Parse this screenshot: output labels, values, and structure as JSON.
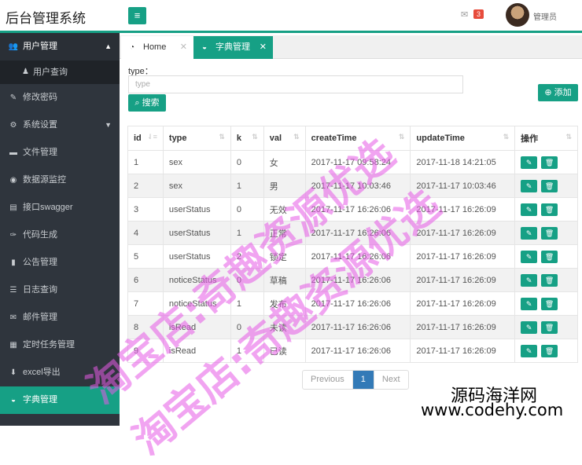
{
  "header": {
    "brand": "后台管理系统",
    "menu_icon": "≡",
    "mail_count": "3",
    "user": "管理员"
  },
  "sidebar": {
    "items": [
      {
        "icon": "users-icon",
        "glyph": "👥",
        "label": "用户管理"
      },
      {
        "icon": "key-icon",
        "glyph": "✎",
        "label": "修改密码"
      },
      {
        "icon": "gears-icon",
        "glyph": "⚙",
        "label": "系统设置"
      },
      {
        "icon": "folder-icon",
        "glyph": "▬",
        "label": "文件管理"
      },
      {
        "icon": "eye-icon",
        "glyph": "◉",
        "label": "数据源监控"
      },
      {
        "icon": "file-pdf-icon",
        "glyph": "▤",
        "label": "接口swagger"
      },
      {
        "icon": "wrench-icon",
        "glyph": "✑",
        "label": "代码生成"
      },
      {
        "icon": "book-icon",
        "glyph": "▮",
        "label": "公告管理"
      },
      {
        "icon": "list-icon",
        "glyph": "☰",
        "label": "日志查询"
      },
      {
        "icon": "envelope-icon",
        "glyph": "✉",
        "label": "邮件管理"
      },
      {
        "icon": "tasks-icon",
        "glyph": "▦",
        "label": "定时任务管理"
      },
      {
        "icon": "download-icon",
        "glyph": "⬇",
        "label": "excel导出"
      },
      {
        "icon": "dict-icon",
        "glyph": "◒",
        "label": "字典管理"
      }
    ],
    "sub_item": {
      "icon": "user-icon",
      "glyph": "♟",
      "label": "用户查询"
    }
  },
  "tabs": [
    {
      "label": "Home",
      "glyph": "◔"
    },
    {
      "label": "字典管理",
      "glyph": "◒"
    }
  ],
  "filter": {
    "label": "type：",
    "placeholder": "type",
    "search_label": "搜索",
    "add_label": "添加"
  },
  "table": {
    "columns": [
      "id",
      "type",
      "k",
      "val",
      "createTime",
      "updateTime",
      "操作"
    ],
    "rows": [
      [
        "1",
        "sex",
        "0",
        "女",
        "2017-11-17 09:58:24",
        "2017-11-18 14:21:05"
      ],
      [
        "2",
        "sex",
        "1",
        "男",
        "2017-11-17 10:03:46",
        "2017-11-17 10:03:46"
      ],
      [
        "3",
        "userStatus",
        "0",
        "无效",
        "2017-11-17 16:26:06",
        "2017-11-17 16:26:09"
      ],
      [
        "4",
        "userStatus",
        "1",
        "正常",
        "2017-11-17 16:26:06",
        "2017-11-17 16:26:09"
      ],
      [
        "5",
        "userStatus",
        "2",
        "锁定",
        "2017-11-17 16:26:06",
        "2017-11-17 16:26:09"
      ],
      [
        "6",
        "noticeStatus",
        "0",
        "草稿",
        "2017-11-17 16:26:06",
        "2017-11-17 16:26:09"
      ],
      [
        "7",
        "noticeStatus",
        "1",
        "发布",
        "2017-11-17 16:26:06",
        "2017-11-17 16:26:09"
      ],
      [
        "8",
        "isRead",
        "0",
        "未读",
        "2017-11-17 16:26:06",
        "2017-11-17 16:26:09"
      ],
      [
        "9",
        "isRead",
        "1",
        "已读",
        "2017-11-17 16:26:06",
        "2017-11-17 16:26:09"
      ]
    ]
  },
  "pagination": {
    "previous": "Previous",
    "current": "1",
    "next": "Next"
  },
  "watermark": {
    "line1": "淘宝店:奇趣资源优选",
    "line2": "淘宝店:奇趣资源优选"
  },
  "site": {
    "name": "源码海洋网",
    "url": "www.codehy.com"
  },
  "colors": {
    "accent": "#16a085",
    "sidebar": "#2f353d",
    "page_active": "#337ab7",
    "badge": "#e74c3c"
  }
}
